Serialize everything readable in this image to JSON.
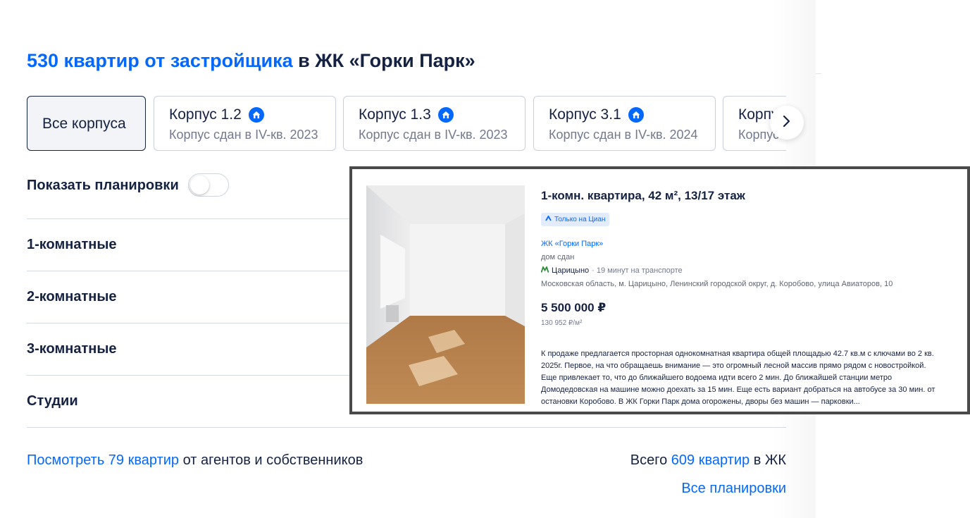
{
  "heading": {
    "link_text": "530 квартир от застройщика",
    "rest_text": "в ЖК «Горки Парк»"
  },
  "buildings": {
    "all_label": "Все корпуса",
    "tabs": [
      {
        "title": "Корпус 1.2",
        "subtitle": "Корпус сдан в IV-кв. 2023"
      },
      {
        "title": "Корпус 1.3",
        "subtitle": "Корпус сдан в IV-кв. 2023"
      },
      {
        "title": "Корпус 3.1",
        "subtitle": "Корпус сдан в IV-кв. 2024"
      },
      {
        "title": "Корпус",
        "subtitle": "Корпус"
      }
    ]
  },
  "layouts_toggle": {
    "label": "Показать планировки"
  },
  "room_types": [
    "1-комнатные",
    "2-комнатные",
    "3-комнатные",
    "Студии"
  ],
  "footer": {
    "agents_link": "Посмотреть 79 квартир",
    "agents_rest": "от агентов и собственников",
    "total_prefix": "Всего",
    "total_link": "609 квартир",
    "total_suffix": "в ЖК",
    "all_plans": "Все планировки"
  },
  "listing_card": {
    "title": "1-комн. квартира, 42 м², 13/17 этаж",
    "badge": "Только на Циан",
    "complex": "ЖК «Горки Парк»",
    "house_status": "дом сдан",
    "metro_station": "Царицыно",
    "metro_time": "· 19 минут на транспорте",
    "address": "Московская область, м. Царицыно, Ленинский городской округ, д. Коробово, улица Авиаторов, 10",
    "price": "5 500 000 ₽",
    "price_per_sqm": "130 952 ₽/м²",
    "description": "К продаже предлагается просторная однокомнатная квартира общей площадью 42.7 кв.м с ключами во 2 кв. 2025г. Первое, на что обращаешь внимание — это огромный лесной массив прямо рядом с новостройкой. Еще привлекает то, что до ближайшего водоема идти всего 2 мин. До ближайшей станции метро Домодедовская на машине можно доехать за 15 мин. Еще есть вариант добраться на автобусе за 30 мин. от остановки Коробово. В ЖК Горки Парк дома огорожены, дворы без машин — парковки..."
  },
  "icons": {
    "building": "house-badge-icon",
    "next": "chevron-right-icon",
    "metro": "metro-icon"
  },
  "colors": {
    "accent": "#0468ff",
    "text": "#152242",
    "muted": "#737a8e",
    "metro": "#2e8b3a"
  }
}
